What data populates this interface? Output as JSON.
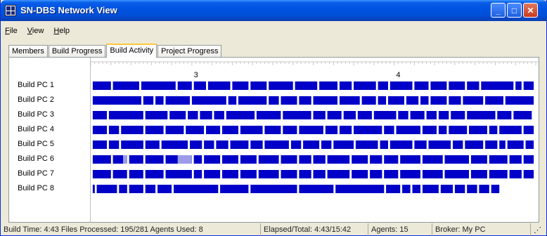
{
  "window": {
    "title": "SN-DBS Network View"
  },
  "menu": [
    {
      "key": "F",
      "rest": "ile"
    },
    {
      "key": "V",
      "rest": "iew"
    },
    {
      "key": "H",
      "rest": "elp"
    }
  ],
  "tabs": [
    {
      "label": "Members",
      "active": false
    },
    {
      "label": "Build Progress",
      "active": false
    },
    {
      "label": "Build Activity",
      "active": true
    },
    {
      "label": "Project Progress",
      "active": false
    }
  ],
  "chart_data": {
    "type": "timeline",
    "x_ticks": [
      {
        "label": "3",
        "value": 3
      },
      {
        "label": "4",
        "value": 4
      }
    ],
    "x_range": [
      2.48,
      4.68
    ],
    "rows": [
      {
        "name": "Build PC 1",
        "blocks": [
          [
            2.49,
            2.58
          ],
          [
            2.59,
            2.72
          ],
          [
            2.73,
            2.9
          ],
          [
            2.91,
            2.98
          ],
          [
            2.99,
            3.05
          ],
          [
            3.06,
            3.17
          ],
          [
            3.18,
            3.26
          ],
          [
            3.27,
            3.35
          ],
          [
            3.36,
            3.48
          ],
          [
            3.49,
            3.6
          ],
          [
            3.61,
            3.7
          ],
          [
            3.71,
            3.77
          ],
          [
            3.78,
            3.89
          ],
          [
            3.9,
            3.95
          ],
          [
            3.96,
            4.07
          ],
          [
            4.08,
            4.15
          ],
          [
            4.16,
            4.24
          ],
          [
            4.25,
            4.33
          ],
          [
            4.34,
            4.4
          ],
          [
            4.41,
            4.57
          ],
          [
            4.58,
            4.61
          ],
          [
            4.62,
            4.67
          ]
        ]
      },
      {
        "name": "Build PC 2",
        "blocks": [
          [
            2.49,
            2.73
          ],
          [
            2.74,
            2.79
          ],
          [
            2.8,
            2.84
          ],
          [
            2.85,
            2.97
          ],
          [
            2.98,
            3.15
          ],
          [
            3.16,
            3.2
          ],
          [
            3.21,
            3.35
          ],
          [
            3.36,
            3.41
          ],
          [
            3.42,
            3.5
          ],
          [
            3.51,
            3.57
          ],
          [
            3.58,
            3.7
          ],
          [
            3.71,
            3.81
          ],
          [
            3.82,
            3.89
          ],
          [
            3.9,
            3.94
          ],
          [
            3.95,
            4.03
          ],
          [
            4.04,
            4.1
          ],
          [
            4.11,
            4.15
          ],
          [
            4.16,
            4.24
          ],
          [
            4.25,
            4.31
          ],
          [
            4.32,
            4.42
          ],
          [
            4.43,
            4.52
          ],
          [
            4.53,
            4.67
          ]
        ]
      },
      {
        "name": "Build PC 3",
        "blocks": [
          [
            2.49,
            2.56
          ],
          [
            2.57,
            2.74
          ],
          [
            2.75,
            2.86
          ],
          [
            2.87,
            2.95
          ],
          [
            2.96,
            3.01
          ],
          [
            3.02,
            3.08
          ],
          [
            3.09,
            3.14
          ],
          [
            3.15,
            3.29
          ],
          [
            3.3,
            3.42
          ],
          [
            3.43,
            3.57
          ],
          [
            3.58,
            3.64
          ],
          [
            3.65,
            3.72
          ],
          [
            3.73,
            3.79
          ],
          [
            3.8,
            3.87
          ],
          [
            3.88,
            3.99
          ],
          [
            4.0,
            4.05
          ],
          [
            4.06,
            4.13
          ],
          [
            4.14,
            4.19
          ],
          [
            4.2,
            4.25
          ],
          [
            4.26,
            4.33
          ],
          [
            4.34,
            4.48
          ],
          [
            4.49,
            4.56
          ],
          [
            4.57,
            4.66
          ]
        ]
      },
      {
        "name": "Build PC 4",
        "blocks": [
          [
            2.49,
            2.56
          ],
          [
            2.57,
            2.62
          ],
          [
            2.63,
            2.74
          ],
          [
            2.75,
            2.84
          ],
          [
            2.85,
            2.94
          ],
          [
            2.95,
            3.04
          ],
          [
            3.05,
            3.12
          ],
          [
            3.13,
            3.21
          ],
          [
            3.22,
            3.33
          ],
          [
            3.34,
            3.42
          ],
          [
            3.43,
            3.5
          ],
          [
            3.51,
            3.63
          ],
          [
            3.64,
            3.7
          ],
          [
            3.71,
            3.77
          ],
          [
            3.78,
            3.92
          ],
          [
            3.93,
            3.98
          ],
          [
            3.99,
            4.11
          ],
          [
            4.12,
            4.19
          ],
          [
            4.2,
            4.24
          ],
          [
            4.25,
            4.34
          ],
          [
            4.35,
            4.44
          ],
          [
            4.45,
            4.49
          ],
          [
            4.5,
            4.61
          ],
          [
            4.62,
            4.67
          ]
        ]
      },
      {
        "name": "Build PC 5",
        "blocks": [
          [
            2.49,
            2.56
          ],
          [
            2.57,
            2.62
          ],
          [
            2.63,
            2.74
          ],
          [
            2.75,
            2.82
          ],
          [
            2.83,
            2.96
          ],
          [
            2.97,
            3.03
          ],
          [
            3.04,
            3.09
          ],
          [
            3.1,
            3.16
          ],
          [
            3.17,
            3.26
          ],
          [
            3.27,
            3.33
          ],
          [
            3.34,
            3.46
          ],
          [
            3.47,
            3.52
          ],
          [
            3.53,
            3.61
          ],
          [
            3.62,
            3.67
          ],
          [
            3.68,
            3.78
          ],
          [
            3.79,
            3.9
          ],
          [
            3.91,
            3.95
          ],
          [
            3.96,
            4.07
          ],
          [
            4.08,
            4.14
          ],
          [
            4.15,
            4.26
          ],
          [
            4.27,
            4.32
          ],
          [
            4.33,
            4.42
          ],
          [
            4.43,
            4.49
          ],
          [
            4.5,
            4.53
          ],
          [
            4.54,
            4.62
          ],
          [
            4.63,
            4.67
          ]
        ]
      },
      {
        "name": "Build PC 6",
        "blocks": [
          [
            2.49,
            2.58
          ],
          [
            2.59,
            2.66
          ],
          [
            2.67,
            2.74
          ],
          [
            2.75,
            2.84
          ],
          [
            2.85,
            2.98
          ],
          [
            2.99,
            3.03
          ],
          [
            3.04,
            3.12
          ],
          [
            3.13,
            3.21
          ],
          [
            3.22,
            3.3
          ],
          [
            3.31,
            3.41
          ],
          [
            3.42,
            3.5
          ],
          [
            3.51,
            3.57
          ],
          [
            3.58,
            3.64
          ],
          [
            3.65,
            3.76
          ],
          [
            3.77,
            3.85
          ],
          [
            3.86,
            3.92
          ],
          [
            3.93,
            4.0
          ],
          [
            4.01,
            4.11
          ],
          [
            4.12,
            4.22
          ],
          [
            4.23,
            4.35
          ],
          [
            4.36,
            4.44
          ],
          [
            4.45,
            4.54
          ],
          [
            4.55,
            4.61
          ],
          [
            4.62,
            4.67
          ]
        ]
      },
      {
        "name": "Build PC 7",
        "blocks": [
          [
            2.49,
            2.58
          ],
          [
            2.59,
            2.66
          ],
          [
            2.67,
            2.74
          ],
          [
            2.75,
            2.84
          ],
          [
            2.85,
            2.98
          ],
          [
            2.99,
            3.03
          ],
          [
            3.04,
            3.12
          ],
          [
            3.13,
            3.21
          ],
          [
            3.22,
            3.3
          ],
          [
            3.31,
            3.41
          ],
          [
            3.42,
            3.5
          ],
          [
            3.51,
            3.57
          ],
          [
            3.58,
            3.64
          ],
          [
            3.65,
            3.76
          ],
          [
            3.77,
            3.85
          ],
          [
            3.86,
            3.92
          ],
          [
            3.93,
            4.0
          ],
          [
            4.01,
            4.11
          ],
          [
            4.12,
            4.22
          ],
          [
            4.23,
            4.35
          ],
          [
            4.36,
            4.44
          ],
          [
            4.45,
            4.54
          ],
          [
            4.55,
            4.61
          ],
          [
            4.62,
            4.67
          ]
        ]
      },
      {
        "name": "Build PC 8",
        "blocks": [
          [
            2.49,
            2.5
          ],
          [
            2.51,
            2.61
          ],
          [
            2.62,
            2.66
          ],
          [
            2.67,
            2.74
          ],
          [
            2.75,
            2.8
          ],
          [
            2.81,
            2.88
          ],
          [
            2.89,
            3.11
          ],
          [
            3.12,
            3.26
          ],
          [
            3.27,
            3.5
          ],
          [
            3.51,
            3.68
          ],
          [
            3.69,
            3.93
          ],
          [
            3.94,
            4.01
          ],
          [
            4.02,
            4.06
          ],
          [
            4.07,
            4.11
          ],
          [
            4.12,
            4.2
          ],
          [
            4.21,
            4.27
          ],
          [
            4.28,
            4.33
          ],
          [
            4.34,
            4.39
          ],
          [
            4.4,
            4.45
          ],
          [
            4.46,
            4.5
          ]
        ]
      }
    ],
    "highlights": [
      {
        "row": 5,
        "range": [
          2.64,
          2.66
        ]
      },
      {
        "row": 5,
        "range": [
          2.91,
          2.98
        ]
      }
    ],
    "colors": {
      "block": "#0000c8",
      "highlight": "#9b9bea"
    }
  },
  "status": {
    "build_summary": "Build Time: 4:43  Files Processed: 195/281  Agents Used: 8",
    "elapsed": "Elapsed/Total: 4:43/15:42",
    "agents": "Agents: 15",
    "broker": "Broker: My PC"
  }
}
